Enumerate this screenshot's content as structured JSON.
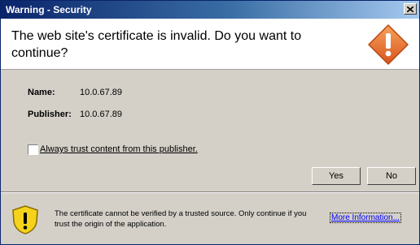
{
  "window": {
    "title": "Warning - Security"
  },
  "headline": "The web site's certificate is invalid.  Do you want to continue?",
  "details": [
    {
      "label": "Name:",
      "value": "10.0.67.89"
    },
    {
      "label": "Publisher:",
      "value": "10.0.67.89"
    }
  ],
  "trust_checkbox": {
    "label": "Always trust content from this publisher.",
    "checked": false
  },
  "buttons": {
    "yes": "Yes",
    "no": "No"
  },
  "footer": {
    "message": "The certificate cannot be verified by a trusted source.  Only continue if you trust the origin of the application.",
    "link": "More Information..."
  },
  "colors": {
    "titlebar_start": "#0a246a",
    "warning_orange": "#e8731f",
    "shield_yellow": "#f5d31c",
    "link": "#0000ff"
  },
  "icons": {
    "close": "close-icon",
    "header_warning": "warning-diamond-icon",
    "footer_warning": "warning-shield-icon"
  }
}
